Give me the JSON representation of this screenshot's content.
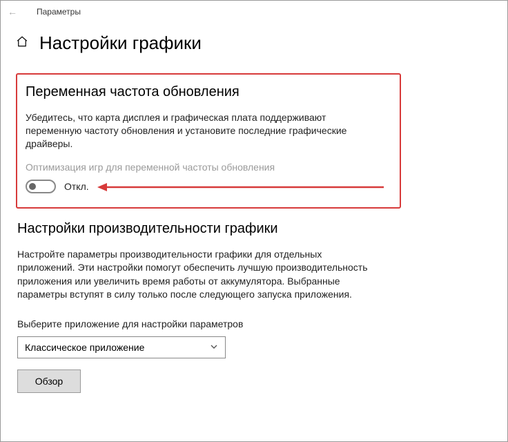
{
  "window": {
    "title": "Параметры"
  },
  "page": {
    "title": "Настройки графики"
  },
  "vrr": {
    "heading": "Переменная частота обновления",
    "desc": "Убедитесь, что карта дисплея и графическая плата поддерживают переменную частоту обновления и установите последние графические драйверы.",
    "opt_label": "Оптимизация игр для переменной частоты обновления",
    "toggle_state": "Откл."
  },
  "perf": {
    "heading": "Настройки производительности графики",
    "desc": "Настройте параметры производительности графики для отдельных приложений. Эти настройки помогут обеспечить лучшую производительность приложения или увеличить время работы от аккумулятора. Выбранные параметры вступят в силу только после следующего запуска приложения.",
    "select_label": "Выберите приложение для настройки параметров",
    "select_value": "Классическое приложение",
    "browse_label": "Обзор"
  },
  "colors": {
    "highlight": "#d73a3a"
  }
}
